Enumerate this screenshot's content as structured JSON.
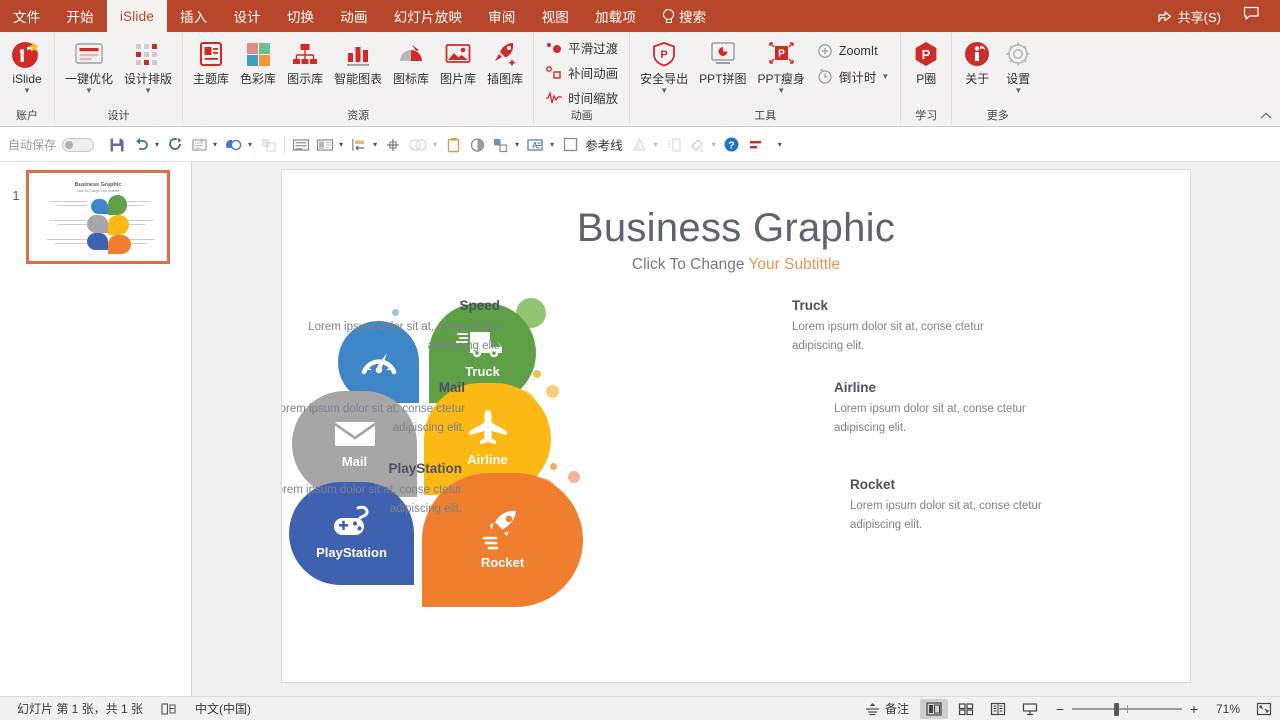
{
  "menubar": {
    "items": [
      {
        "label": "文件",
        "active": false
      },
      {
        "label": "开始",
        "active": false
      },
      {
        "label": "iSlide",
        "active": true
      },
      {
        "label": "插入",
        "active": false
      },
      {
        "label": "设计",
        "active": false
      },
      {
        "label": "切换",
        "active": false
      },
      {
        "label": "动画",
        "active": false
      },
      {
        "label": "幻灯片放映",
        "active": false
      },
      {
        "label": "审阅",
        "active": false
      },
      {
        "label": "视图",
        "active": false
      },
      {
        "label": "加载项",
        "active": false
      }
    ],
    "search_label": "搜索",
    "search_icon": "lightbulb-icon",
    "share_label": "共享(S)",
    "share_icon": "share-icon",
    "comment_icon": "comment-icon",
    "bar_color": "#b7472a"
  },
  "ribbon": {
    "collapse_icon": "chevron-up-icon",
    "groups": [
      {
        "title": "账户",
        "buttons": [
          {
            "label": "iSlide",
            "icon": "islide-logo-icon",
            "caret": true
          }
        ]
      },
      {
        "title": "设计",
        "buttons": [
          {
            "label": "一键优化",
            "icon": "optimize-icon",
            "caret": true
          },
          {
            "label": "设计排版",
            "icon": "layout-grid-icon",
            "caret": true
          }
        ]
      },
      {
        "title": "资源",
        "buttons": [
          {
            "label": "主题库",
            "icon": "theme-library-icon",
            "caret": false
          },
          {
            "label": "色彩库",
            "icon": "color-library-icon",
            "caret": false
          },
          {
            "label": "图示库",
            "icon": "diagram-library-icon",
            "caret": false
          },
          {
            "label": "智能图表",
            "icon": "smart-chart-icon",
            "caret": false
          },
          {
            "label": "图标库",
            "icon": "icon-library-icon",
            "caret": false
          },
          {
            "label": "图片库",
            "icon": "image-library-icon",
            "caret": false
          },
          {
            "label": "插图库",
            "icon": "illustration-library-icon",
            "caret": false
          }
        ]
      },
      {
        "title": "动画",
        "small_buttons": [
          {
            "label": "平滑过渡",
            "icon": "morph-transition-icon"
          },
          {
            "label": "补间动画",
            "icon": "tween-animation-icon"
          },
          {
            "label": "时间缩放",
            "icon": "time-scale-icon"
          }
        ]
      },
      {
        "title": "工具",
        "buttons": [
          {
            "label": "安全导出",
            "icon": "safe-export-icon",
            "caret": true
          },
          {
            "label": "PPT拼图",
            "icon": "ppt-collage-icon",
            "caret": false
          },
          {
            "label": "PPT瘦身",
            "icon": "ppt-slim-icon",
            "caret": true
          }
        ],
        "small_buttons": [
          {
            "label": "ZoomIt",
            "icon": "zoomit-icon"
          },
          {
            "label": "倒计时",
            "icon": "countdown-icon",
            "caret": true
          }
        ]
      },
      {
        "title": "学习",
        "buttons": [
          {
            "label": "P圈",
            "icon": "p-circle-icon",
            "caret": false
          }
        ]
      },
      {
        "title": "更多",
        "buttons": [
          {
            "label": "关于",
            "icon": "about-icon",
            "caret": false
          },
          {
            "label": "设置",
            "icon": "gear-icon",
            "caret": true
          }
        ]
      }
    ]
  },
  "qat": {
    "autosave_label": "自动保存",
    "autosave_state": "off",
    "items": [
      {
        "name": "save-icon",
        "caret": false
      },
      {
        "name": "undo-icon",
        "caret": true
      },
      {
        "name": "redo-icon",
        "caret": false
      },
      {
        "name": "new-slide-icon",
        "caret": true
      },
      {
        "name": "shapes-icon",
        "caret": true
      },
      {
        "name": "duplicate-icon",
        "caret": false,
        "disabled": true
      },
      {
        "name": "slide-master-icon",
        "caret": false
      },
      {
        "name": "layout-icon",
        "caret": true
      },
      {
        "name": "align-icon",
        "caret": true
      },
      {
        "name": "rotate-icon",
        "caret": false
      },
      {
        "name": "merge-shapes-icon",
        "caret": true,
        "disabled": true
      },
      {
        "name": "clipboard-icon",
        "caret": false
      },
      {
        "name": "contrast-icon",
        "caret": false
      },
      {
        "name": "group-icon",
        "caret": true
      },
      {
        "name": "text-box-icon",
        "caret": true
      },
      {
        "name": "guides-icon",
        "caret": false
      }
    ],
    "guides_label": "参考线",
    "items_after": [
      {
        "name": "animation-pane-icon",
        "caret": true,
        "disabled": true
      },
      {
        "name": "selection-pane-icon",
        "caret": false,
        "disabled": true
      },
      {
        "name": "format-painter-icon",
        "caret": true,
        "disabled": true
      },
      {
        "name": "help-icon",
        "caret": false
      },
      {
        "name": "ruler-icon",
        "caret": false
      }
    ],
    "overflow_icon": "more-commands-icon"
  },
  "thumbnails": {
    "slides": [
      {
        "number": "1",
        "title": "Business Graphic",
        "subtitle": "Click To Change Your Subtittle",
        "selected": true
      }
    ]
  },
  "slide": {
    "title": "Business Graphic",
    "subtitle_prefix": "Click To Change ",
    "subtitle_highlight": "Your Subtittle",
    "highlight_color": "#e8964b",
    "title_color": "#5c6472",
    "petals": [
      {
        "id": "speed",
        "label": "Speed",
        "icon": "speedometer-icon",
        "color": "#3f86c8",
        "side": "left"
      },
      {
        "id": "mail",
        "label": "Mail",
        "icon": "envelope-icon",
        "color": "#a6a6a6",
        "side": "left"
      },
      {
        "id": "playstation",
        "label": "PlayStation",
        "icon": "gamepad-icon",
        "color": "#3e62b0",
        "side": "left"
      },
      {
        "id": "truck",
        "label": "Truck",
        "icon": "truck-icon",
        "color": "#5fa046",
        "side": "right"
      },
      {
        "id": "airline",
        "label": "Airline",
        "icon": "airplane-icon",
        "color": "#fcb913",
        "side": "right"
      },
      {
        "id": "rocket",
        "label": "Rocket",
        "icon": "rocket-icon",
        "color": "#ef7f2e",
        "side": "right"
      }
    ],
    "text_blocks": [
      {
        "id": "speed",
        "heading": "Speed",
        "body": "Lorem ipsum dolor sit at, conse ctetur adipiscing elit.",
        "align": "right"
      },
      {
        "id": "mail",
        "heading": "Mail",
        "body": "Lorem ipsum dolor sit at, conse ctetur adipiscing elit.",
        "align": "right"
      },
      {
        "id": "playstation",
        "heading": "PlayStation",
        "body": "Lorem ipsum dolor sit at, conse ctetur adipiscing elit.",
        "align": "right"
      },
      {
        "id": "truck",
        "heading": "Truck",
        "body": "Lorem ipsum dolor sit at, conse ctetur adipiscing elit.",
        "align": "left"
      },
      {
        "id": "airline",
        "heading": "Airline",
        "body": "Lorem ipsum dolor sit at, conse ctetur adipiscing elit.",
        "align": "left"
      },
      {
        "id": "rocket",
        "heading": "Rocket",
        "body": "Lorem ipsum dolor sit at, conse ctetur adipiscing elit.",
        "align": "left"
      }
    ]
  },
  "statusbar": {
    "slide_count": "幻灯片 第 1 张，共 1 张",
    "accessibility_icon": "accessibility-icon",
    "language": "中文(中国)",
    "notes_label": "备注",
    "notes_icon": "notes-icon",
    "views": [
      {
        "name": "normal-view-button",
        "selected": true
      },
      {
        "name": "slide-sorter-view-button",
        "selected": false
      },
      {
        "name": "reading-view-button",
        "selected": false
      },
      {
        "name": "slideshow-view-button",
        "selected": false
      }
    ],
    "zoom_out": "−",
    "zoom_in": "+",
    "zoom_level": "71%",
    "fit_icon": "fit-to-window-icon"
  }
}
